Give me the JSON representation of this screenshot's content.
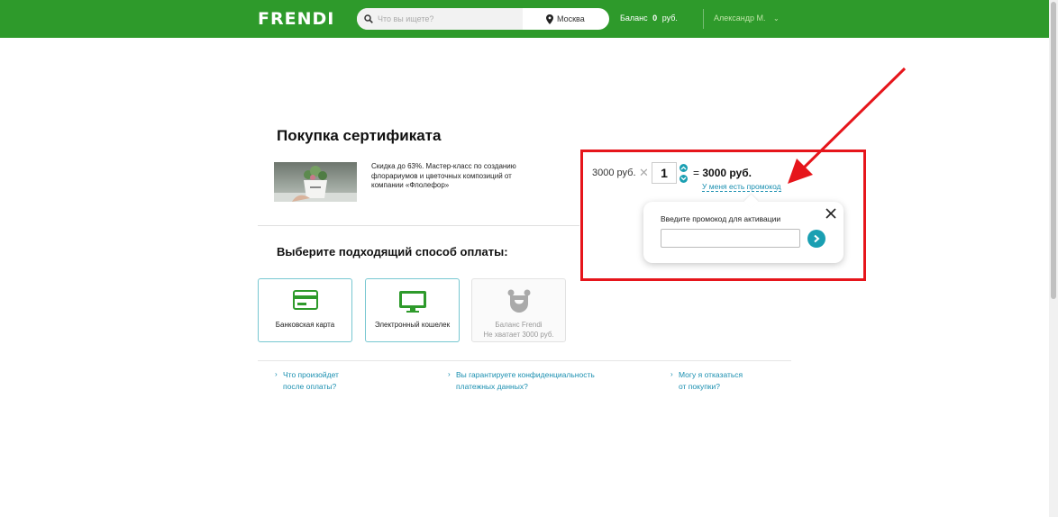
{
  "header": {
    "logo": "FRENDI",
    "search_placeholder": "Что вы ищете?",
    "city": "Москва",
    "balance_label": "Баланс",
    "balance_value": "0",
    "balance_currency": "руб.",
    "user_name": "Александр М.",
    "brand_color": "#2e9a2b"
  },
  "page": {
    "title": "Покупка сертификата",
    "product_description": "Скидка до 63%. Мастер-класс по созданию флорариумов и цветочных композиций от компании «Флолефор»"
  },
  "order": {
    "price": "3000 руб.",
    "times_sign": "✕",
    "quantity": "1",
    "equals_sign": "=",
    "total": "3000 руб.",
    "promo_link": "У меня есть промокод"
  },
  "promo_popup": {
    "label": "Введите промокод для активации",
    "input_value": ""
  },
  "payment": {
    "title": "Выберите подходящий способ оплаты:",
    "methods": [
      {
        "label": "Банковская карта",
        "icon": "credit-card-icon",
        "enabled": true
      },
      {
        "label": "Электронный кошелек",
        "icon": "monitor-icon",
        "enabled": true
      },
      {
        "label": "Баланс Frendi",
        "sublabel": "Не хватает 3000 руб.",
        "icon": "frendi-mascot-icon",
        "enabled": false
      }
    ]
  },
  "faq": [
    {
      "line1": "Что произойдет",
      "line2": "после оплаты?"
    },
    {
      "line1": "Вы гарантируете конфиденциальность",
      "line2": "платежных данных?"
    },
    {
      "line1": "Могу я отказаться",
      "line2": "от покупки?"
    }
  ],
  "colors": {
    "accent": "#1a9fb2",
    "highlight_box": "#e6151b",
    "link": "#1a8fb0"
  }
}
